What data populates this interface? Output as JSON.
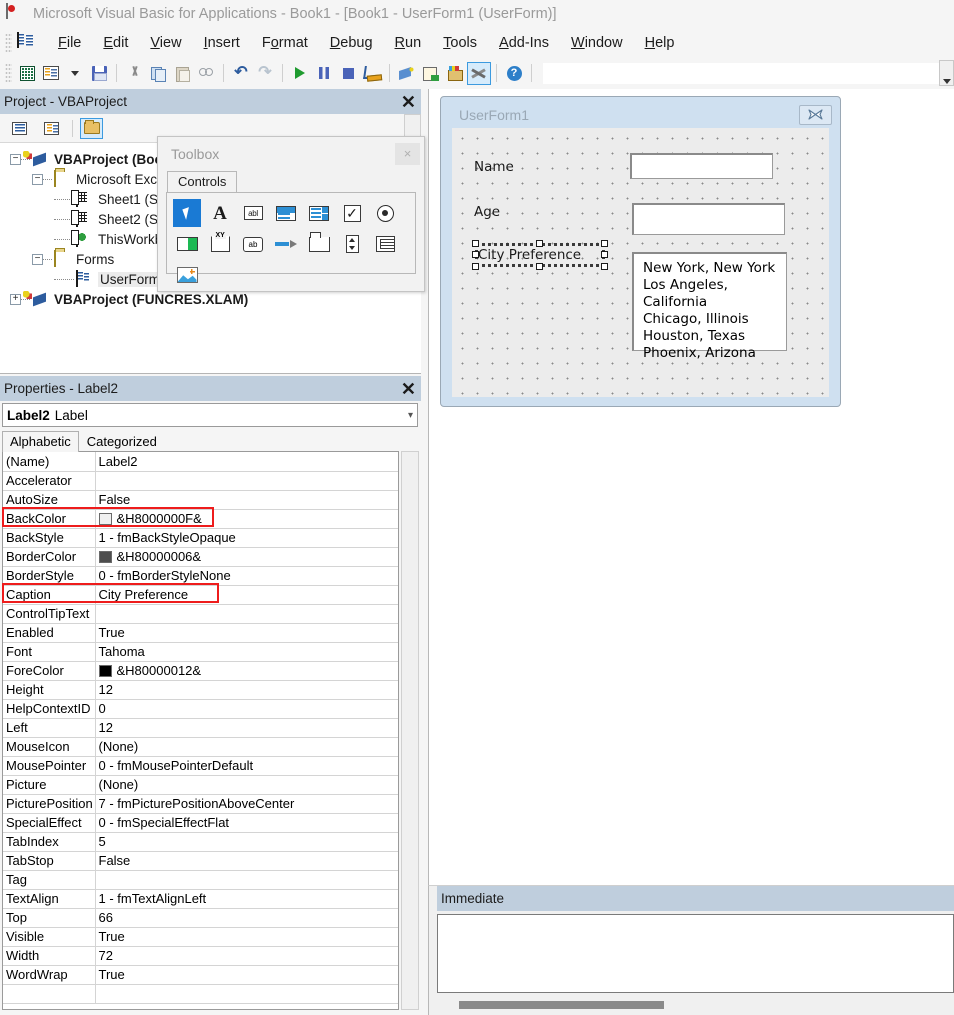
{
  "window": {
    "title": "Microsoft Visual Basic for Applications - Book1 - [Book1 - UserForm1 (UserForm)]",
    "app_icon": "vba-excel-icon"
  },
  "menubar": {
    "lead_icon": "vba-project-icon",
    "items": [
      {
        "label": "File",
        "accel": "F"
      },
      {
        "label": "Edit",
        "accel": "E"
      },
      {
        "label": "View",
        "accel": "V"
      },
      {
        "label": "Insert",
        "accel": "I"
      },
      {
        "label": "Format",
        "accel": "o"
      },
      {
        "label": "Debug",
        "accel": "D"
      },
      {
        "label": "Run",
        "accel": "R"
      },
      {
        "label": "Tools",
        "accel": "T"
      },
      {
        "label": "Add-Ins",
        "accel": "A"
      },
      {
        "label": "Window",
        "accel": "W"
      },
      {
        "label": "Help",
        "accel": "H"
      }
    ]
  },
  "toolbar": {
    "buttons": [
      {
        "name": "view-excel-icon",
        "tooltip": "View Microsoft Excel"
      },
      {
        "name": "insert-userform-icon",
        "tooltip": "Insert UserForm"
      },
      {
        "name": "insert-dropdown-icon",
        "tooltip": "Insert dropdown"
      },
      {
        "name": "save-icon",
        "tooltip": "Save Book1"
      },
      {
        "name": "cut-icon",
        "tooltip": "Cut"
      },
      {
        "name": "copy-icon",
        "tooltip": "Copy"
      },
      {
        "name": "paste-icon",
        "tooltip": "Paste"
      },
      {
        "name": "find-icon",
        "tooltip": "Find"
      },
      {
        "name": "undo-icon",
        "tooltip": "Undo"
      },
      {
        "name": "redo-icon",
        "tooltip": "Redo"
      },
      {
        "name": "run-icon",
        "tooltip": "Run Sub/UserForm"
      },
      {
        "name": "pause-icon",
        "tooltip": "Break"
      },
      {
        "name": "stop-icon",
        "tooltip": "Reset"
      },
      {
        "name": "design-mode-icon",
        "tooltip": "Design Mode"
      },
      {
        "name": "project-explorer-icon",
        "tooltip": "Project Explorer"
      },
      {
        "name": "properties-window-icon",
        "tooltip": "Properties Window"
      },
      {
        "name": "object-browser-icon",
        "tooltip": "Object Browser"
      },
      {
        "name": "toolbox-icon",
        "tooltip": "Toolbox"
      },
      {
        "name": "help-icon",
        "tooltip": "Help"
      }
    ],
    "selected_button": "toolbox-icon",
    "search_value": ""
  },
  "project_explorer": {
    "title": "Project - VBAProject",
    "close_label": "✕",
    "toolbar": [
      {
        "name": "view-code-button",
        "label": "View Code"
      },
      {
        "name": "view-object-button",
        "label": "View Object"
      },
      {
        "name": "toggle-folders-button",
        "label": "Toggle Folders",
        "selected": true
      }
    ],
    "tree": [
      {
        "label": "VBAProject (Boo",
        "icon": "vba-project-icon",
        "depth": 0,
        "bold": true,
        "toggle": "-"
      },
      {
        "label": "Microsoft Exce",
        "icon": "folder-excel-objects-icon",
        "depth": 1,
        "bold": false,
        "toggle": "-"
      },
      {
        "label": "Sheet1 (S",
        "icon": "sheet-icon",
        "depth": 2,
        "bold": false,
        "toggle": ""
      },
      {
        "label": "Sheet2 (S",
        "icon": "sheet-icon",
        "depth": 2,
        "bold": false,
        "toggle": ""
      },
      {
        "label": "ThisWorkb",
        "icon": "workbook-icon",
        "depth": 2,
        "bold": false,
        "toggle": ""
      },
      {
        "label": "Forms",
        "icon": "folder-forms-icon",
        "depth": 1,
        "bold": false,
        "toggle": "-"
      },
      {
        "label": "UserForm",
        "icon": "userform-icon",
        "depth": 2,
        "bold": false,
        "toggle": "",
        "selected": true
      },
      {
        "label": "VBAProject (FUNCRES.XLAM)",
        "icon": "vba-project-icon",
        "depth": 0,
        "bold": true,
        "toggle": "+"
      }
    ]
  },
  "toolbox": {
    "title": "Toolbox",
    "close_label": "×",
    "tabs": [
      {
        "label": "Controls",
        "active": true
      }
    ],
    "controls": [
      {
        "name": "select-objects-tool",
        "icon": "arrow-pointer-icon",
        "label": "Select Objects",
        "selected": true
      },
      {
        "name": "label-tool",
        "icon": "label-A-icon",
        "label": "Label"
      },
      {
        "name": "textbox-tool",
        "icon": "textbox-abl-icon",
        "label": "TextBox"
      },
      {
        "name": "combobox-tool",
        "icon": "combobox-icon",
        "label": "ComboBox"
      },
      {
        "name": "listbox-tool",
        "icon": "listbox-icon",
        "label": "ListBox"
      },
      {
        "name": "checkbox-tool",
        "icon": "checkbox-icon",
        "label": "CheckBox"
      },
      {
        "name": "optionbutton-tool",
        "icon": "radio-button-icon",
        "label": "OptionButton"
      },
      {
        "name": "togglebutton-tool",
        "icon": "toggle-button-icon",
        "label": "ToggleButton"
      },
      {
        "name": "frame-tool",
        "icon": "frame-xy-icon",
        "label": "Frame"
      },
      {
        "name": "commandbutton-tool",
        "icon": "command-button-ab-icon",
        "label": "CommandButton"
      },
      {
        "name": "scrollbar-tool",
        "icon": "scrollbar-icon",
        "label": "ScrollBar"
      },
      {
        "name": "tabstrip-tool",
        "icon": "tabstrip-icon",
        "label": "TabStrip"
      },
      {
        "name": "spinbutton-tool",
        "icon": "spin-button-icon",
        "label": "SpinButton"
      },
      {
        "name": "multipage-tool",
        "icon": "multipage-icon",
        "label": "MultiPage"
      },
      {
        "name": "image-tool",
        "icon": "image-icon",
        "label": "Image"
      }
    ]
  },
  "properties": {
    "title": "Properties - Label2",
    "close_label": "✕",
    "object_name": "Label2",
    "object_type": "Label",
    "dropdown_icon": "chevron-down-icon",
    "tabs": [
      {
        "label": "Alphabetic",
        "active": true
      },
      {
        "label": "Categorized",
        "active": false
      }
    ],
    "rows": [
      {
        "key": "(Name)",
        "value": "Label2"
      },
      {
        "key": "Accelerator",
        "value": ""
      },
      {
        "key": "AutoSize",
        "value": "False"
      },
      {
        "key": "BackColor",
        "value": "&H8000000F&",
        "swatch": "#f0f0f0",
        "highlighted": true
      },
      {
        "key": "BackStyle",
        "value": "1 - fmBackStyleOpaque"
      },
      {
        "key": "BorderColor",
        "value": "&H80000006&",
        "swatch": "#4d4d4d"
      },
      {
        "key": "BorderStyle",
        "value": "0 - fmBorderStyleNone"
      },
      {
        "key": "Caption",
        "value": "City Preference",
        "highlighted": true
      },
      {
        "key": "ControlTipText",
        "value": "",
        "no_border": true
      },
      {
        "key": "Enabled",
        "value": "True"
      },
      {
        "key": "Font",
        "value": "Tahoma"
      },
      {
        "key": "ForeColor",
        "value": "&H80000012&",
        "swatch": "#000000"
      },
      {
        "key": "Height",
        "value": "12"
      },
      {
        "key": "HelpContextID",
        "value": "0"
      },
      {
        "key": "Left",
        "value": "12"
      },
      {
        "key": "MouseIcon",
        "value": "(None)"
      },
      {
        "key": "MousePointer",
        "value": "0 - fmMousePointerDefault"
      },
      {
        "key": "Picture",
        "value": "(None)"
      },
      {
        "key": "PicturePosition",
        "value": "7 - fmPicturePositionAboveCenter"
      },
      {
        "key": "SpecialEffect",
        "value": "0 - fmSpecialEffectFlat"
      },
      {
        "key": "TabIndex",
        "value": "5"
      },
      {
        "key": "TabStop",
        "value": "False"
      },
      {
        "key": "Tag",
        "value": ""
      },
      {
        "key": "TextAlign",
        "value": "1 - fmTextAlignLeft"
      },
      {
        "key": "Top",
        "value": "66"
      },
      {
        "key": "Visible",
        "value": "True"
      },
      {
        "key": "Width",
        "value": "72"
      },
      {
        "key": "WordWrap",
        "value": "True"
      }
    ],
    "highlight_color": "#ee1c1c"
  },
  "designer": {
    "form_caption": "UserForm1",
    "close_icon": "close-x-icon",
    "labels": [
      {
        "name": "name-label",
        "text": "Name"
      },
      {
        "name": "age-label",
        "text": "Age"
      },
      {
        "name": "city-preference-label",
        "text": "City Preference",
        "selected": true
      }
    ],
    "textboxes": [
      {
        "name": "name-textbox",
        "value": ""
      },
      {
        "name": "age-textbox",
        "value": ""
      }
    ],
    "listbox": {
      "name": "city-listbox",
      "items": [
        "New York, New York",
        "Los Angeles, California",
        "Chicago, Illinois",
        "Houston, Texas",
        "Phoenix, Arizona"
      ]
    }
  },
  "immediate": {
    "title": "Immediate",
    "content": ""
  }
}
